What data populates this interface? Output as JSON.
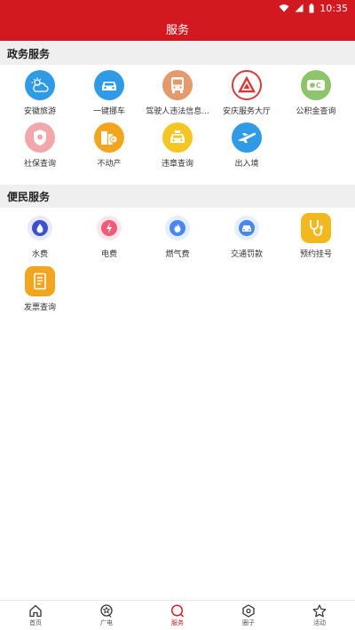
{
  "status_bar": {
    "time": "10:35"
  },
  "header": {
    "title": "服务"
  },
  "sections": [
    {
      "title": "政务服务"
    },
    {
      "title": "便民服务"
    }
  ],
  "gov_services": [
    {
      "label": "安徽旅游",
      "icon": "weather-cloud-icon",
      "color": "#2f9be6"
    },
    {
      "label": "一键挪车",
      "icon": "car-icon",
      "color": "#2f9be6"
    },
    {
      "label": "驾驶人违法信息...",
      "icon": "bus-icon",
      "color": "#e49a6b"
    },
    {
      "label": "安庆服务大厅",
      "icon": "service-logo-icon",
      "color": "#d63a3a"
    },
    {
      "label": "公积金查询",
      "icon": "fund-card-icon",
      "color": "#8cc56a"
    },
    {
      "label": "社保查询",
      "icon": "shield-icon",
      "color": "#f2a7ad"
    },
    {
      "label": "不动产",
      "icon": "building-icon",
      "color": "#f2a51e"
    },
    {
      "label": "违章查询",
      "icon": "taxi-icon",
      "color": "#f5c623"
    },
    {
      "label": "出入境",
      "icon": "airplane-icon",
      "color": "#2f9be6"
    }
  ],
  "life_services": [
    {
      "label": "水费",
      "icon": "water-drop-icon",
      "color": "#3b4fd1",
      "halo": "#e8eafc"
    },
    {
      "label": "电费",
      "icon": "lightning-icon",
      "color": "#f25a78",
      "halo": "#fde6ec"
    },
    {
      "label": "燃气费",
      "icon": "flame-icon",
      "color": "#4a86f0",
      "halo": "#e4eefd"
    },
    {
      "label": "交通罚款",
      "icon": "car-front-icon",
      "color": "#4a86f0",
      "halo": "#e4eefd"
    },
    {
      "label": "预约挂号",
      "icon": "stethoscope-icon",
      "color": "#f2b91e",
      "halo": "#f2b91e"
    },
    {
      "label": "发票查询",
      "icon": "receipt-icon",
      "color": "#f2a51e",
      "halo": "#f2a51e"
    }
  ],
  "tabs": [
    {
      "label": "首页",
      "icon": "home-icon"
    },
    {
      "label": "广电",
      "icon": "star-badge-icon"
    },
    {
      "label": "服务",
      "icon": "search-service-icon",
      "active": true
    },
    {
      "label": "圈子",
      "icon": "hexagon-icon"
    },
    {
      "label": "活动",
      "icon": "star-icon"
    }
  ],
  "accent_color": "#d21920"
}
